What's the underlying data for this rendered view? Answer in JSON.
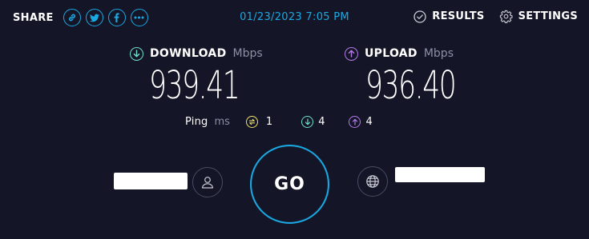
{
  "share": {
    "label": "SHARE",
    "buttons": [
      {
        "icon": "link-icon"
      },
      {
        "icon": "twitter-icon"
      },
      {
        "icon": "facebook-icon"
      },
      {
        "icon": "more-icon"
      }
    ]
  },
  "timestamp": "01/23/2023 7:05 PM",
  "top_links": {
    "results": "RESULTS",
    "settings": "SETTINGS"
  },
  "download": {
    "label": "DOWNLOAD",
    "unit": "Mbps",
    "value": "939.41",
    "color": "#6ee0cc"
  },
  "upload": {
    "label": "UPLOAD",
    "unit": "Mbps",
    "value": "936.40",
    "color": "#b57be8"
  },
  "ping": {
    "label": "Ping",
    "unit": "ms",
    "idle": "1",
    "download": "4",
    "upload": "4",
    "idle_color": "#f1e26b",
    "download_color": "#6ee0cc",
    "upload_color": "#b57be8"
  },
  "go_label": "GO",
  "colors": {
    "accent": "#1ba9e3",
    "background": "#141526"
  }
}
